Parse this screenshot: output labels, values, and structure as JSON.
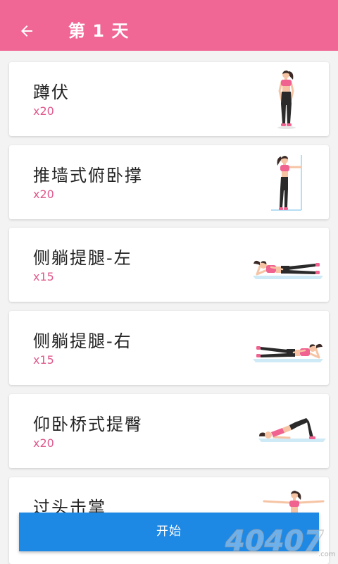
{
  "colors": {
    "header": "#F06694",
    "accent": "#E0588C",
    "button": "#1E88E5",
    "background": "#F3F3F3",
    "card": "#FFFFFF"
  },
  "header": {
    "back_icon": "arrow-left-icon",
    "title": "第 1 天"
  },
  "exercises": [
    {
      "name": "蹲伏",
      "reps": "x20",
      "icon": "squat-figure-icon"
    },
    {
      "name": "推墙式俯卧撑",
      "reps": "x20",
      "icon": "wall-push-up-figure-icon"
    },
    {
      "name": "侧躺提腿-左",
      "reps": "x15",
      "icon": "side-lying-leg-raise-left-figure-icon"
    },
    {
      "name": "侧躺提腿-右",
      "reps": "x15",
      "icon": "side-lying-leg-raise-right-figure-icon"
    },
    {
      "name": "仰卧桥式提臀",
      "reps": "x20",
      "icon": "glute-bridge-figure-icon"
    },
    {
      "name": "过头击掌",
      "icon": "overhead-clap-figure-icon"
    }
  ],
  "start_button": {
    "label": "开始"
  },
  "watermark": {
    "mark": "40407",
    "suffix": ".com"
  }
}
